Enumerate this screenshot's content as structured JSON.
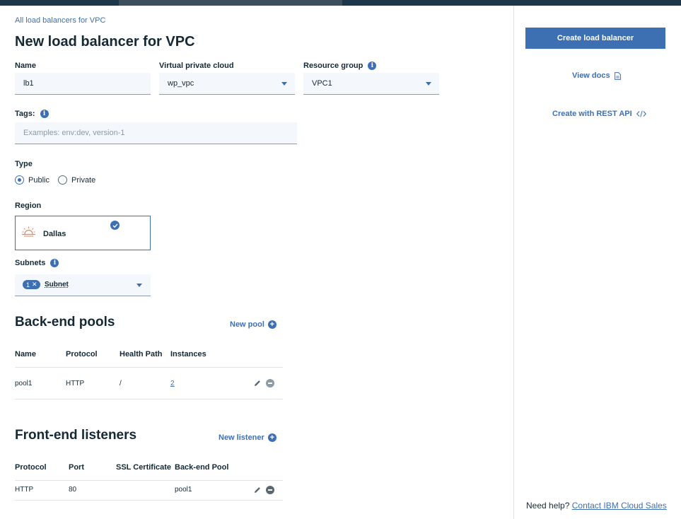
{
  "breadcrumb": "All load balancers for VPC",
  "page_title": "New load balancer for VPC",
  "form": {
    "name": {
      "label": "Name",
      "value": "lb1"
    },
    "vpc": {
      "label": "Virtual private cloud",
      "value": "wp_vpc"
    },
    "resource_group": {
      "label": "Resource group",
      "value": "VPC1"
    },
    "tags": {
      "label": "Tags:",
      "placeholder": "Examples: env:dev, version-1"
    },
    "type": {
      "label": "Type",
      "options": [
        "Public",
        "Private"
      ],
      "selected": "Public"
    },
    "region": {
      "label": "Region",
      "selected": "Dallas",
      "icon": "sun-icon"
    },
    "subnets": {
      "label": "Subnets",
      "count": "1",
      "value": "Subnet"
    }
  },
  "backend_pools": {
    "title": "Back-end pools",
    "add_label": "New pool",
    "columns": [
      "Name",
      "Protocol",
      "Health Path",
      "Instances"
    ],
    "rows": [
      {
        "name": "pool1",
        "protocol": "HTTP",
        "health_path": "/",
        "instances": "2"
      }
    ]
  },
  "frontend_listeners": {
    "title": "Front-end listeners",
    "add_label": "New listener",
    "columns": [
      "Protocol",
      "Port",
      "SSL Certificate",
      "Back-end Pool"
    ],
    "rows": [
      {
        "protocol": "HTTP",
        "port": "80",
        "ssl": "",
        "pool": "pool1"
      }
    ]
  },
  "sidebar": {
    "create_button": "Create load balancer",
    "view_docs": "View docs",
    "rest_api": "Create with REST API",
    "help_text": "Need help?",
    "help_link": "Contact IBM Cloud Sales"
  },
  "colors": {
    "accent": "#3d70b2",
    "text": "#152935",
    "field_bg": "#f4f7fb",
    "topbar": "#1d3649"
  }
}
